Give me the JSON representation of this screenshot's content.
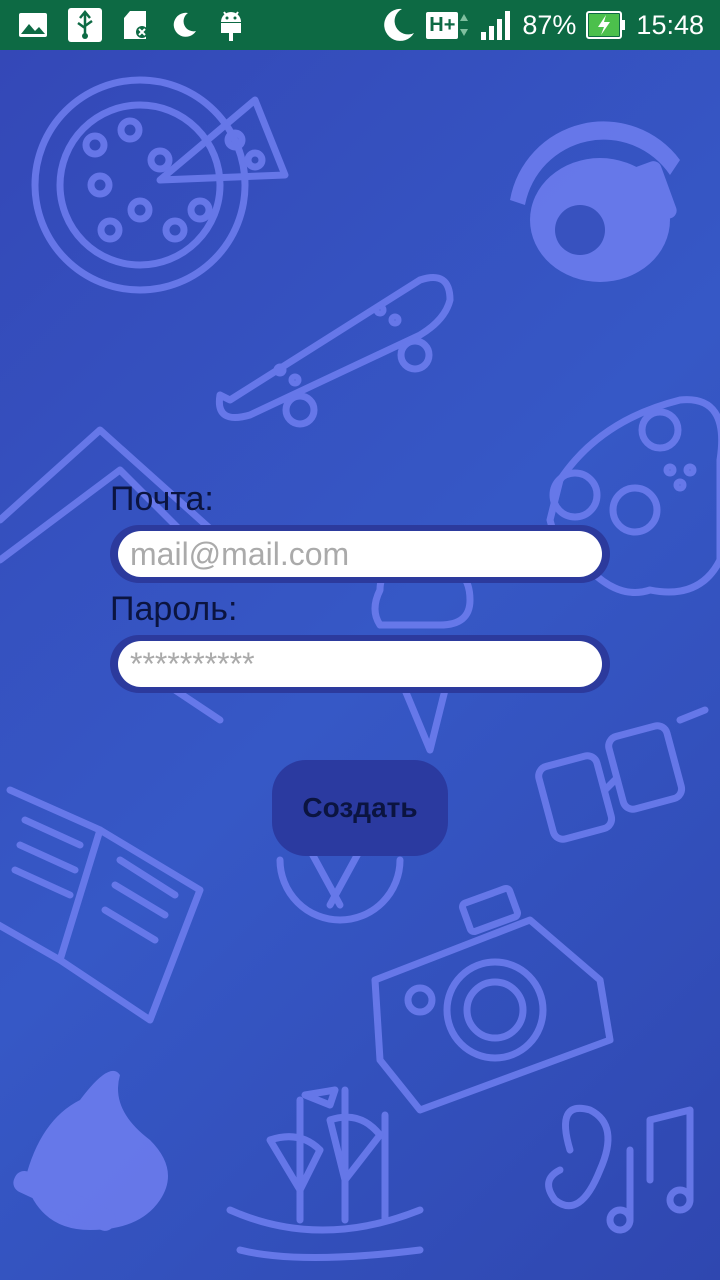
{
  "status_bar": {
    "left_icons": [
      "gallery-icon",
      "usb-icon",
      "sd-card-icon",
      "moon-icon",
      "android-icon"
    ],
    "network": "H+",
    "battery": "87%",
    "time": "15:48"
  },
  "form": {
    "email_label": "Почта:",
    "email_placeholder": "mail@mail.com",
    "password_label": "Пароль:",
    "password_placeholder": "**********",
    "submit_label": "Создать"
  },
  "colors": {
    "status_bar": "#0d6a44",
    "background": "#3046b6",
    "doodle": "#6f7ff0",
    "input_border": "#2c3a9d",
    "button": "#2b3aa0",
    "label_text": "#0b1440"
  }
}
